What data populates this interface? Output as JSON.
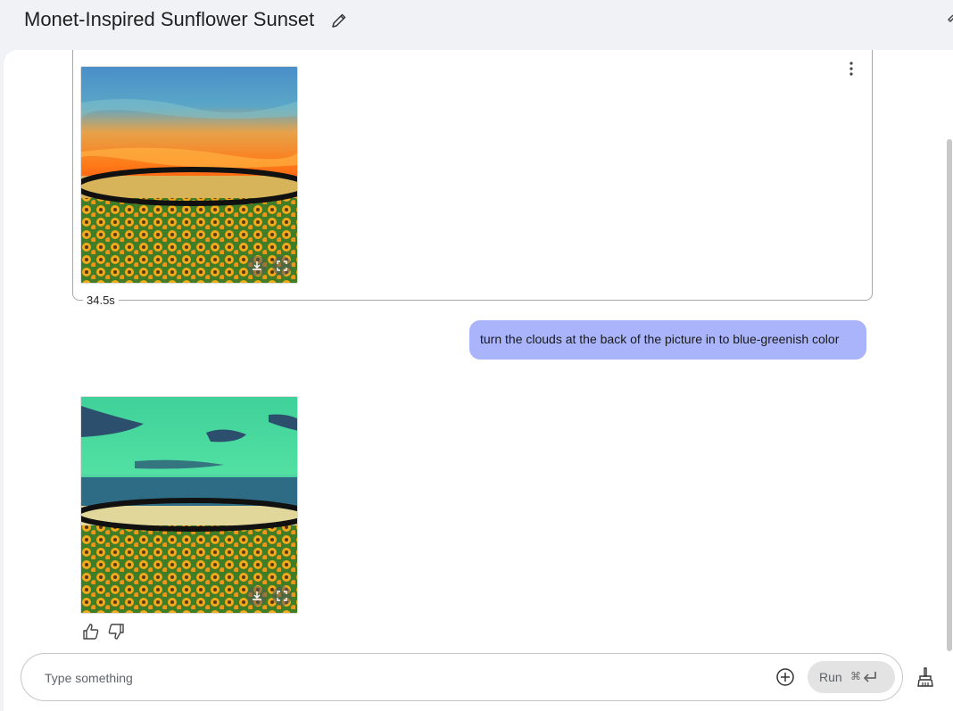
{
  "header": {
    "title": "Monet-Inspired Sunflower Sunset"
  },
  "chat": {
    "previous_turn": {
      "duration": "34.5s"
    },
    "user_message": "turn the clouds at the back of the picture in to blue-greenish color"
  },
  "composer": {
    "placeholder": "Type something",
    "value": "",
    "run_label": "Run",
    "run_shortcut": "⌘"
  },
  "icons": {
    "edit": "pencil-icon",
    "menu": "more-vert-icon",
    "download": "download-icon",
    "fullscreen": "fullscreen-icon",
    "thumbs_up": "thumbs-up-icon",
    "thumbs_down": "thumbs-down-icon",
    "add": "add-circle-icon",
    "enter": "enter-key-icon",
    "clear": "broom-icon"
  },
  "colors": {
    "user_bubble": "#aab4fa",
    "page_bg": "#f1f2f5",
    "run_button_bg": "#e3e3e3"
  }
}
